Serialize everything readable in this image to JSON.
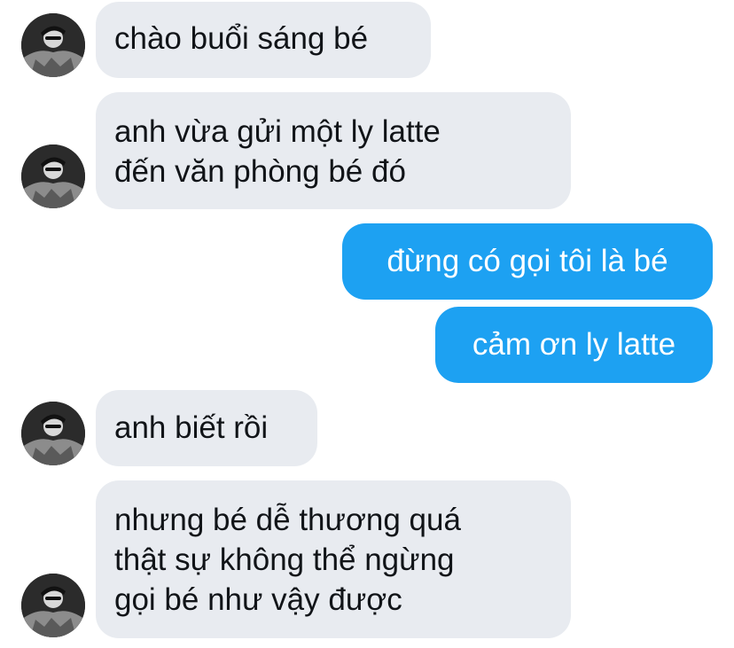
{
  "conversation": {
    "messages": [
      {
        "direction": "incoming",
        "lines": [
          "chào buổi sáng bé"
        ]
      },
      {
        "direction": "incoming",
        "lines": [
          "anh vừa gửi một ly latte",
          "đến văn phòng bé đó"
        ]
      },
      {
        "direction": "outgoing",
        "lines": [
          "đừng có gọi tôi là bé"
        ]
      },
      {
        "direction": "outgoing",
        "lines": [
          "cảm ơn ly latte"
        ]
      },
      {
        "direction": "incoming",
        "lines": [
          "anh biết rồi"
        ]
      },
      {
        "direction": "incoming",
        "lines": [
          "nhưng bé dễ thương quá",
          "thật sự không thể ngừng",
          "gọi bé như vậy được"
        ]
      }
    ]
  },
  "colors": {
    "incoming_bubble": "#e8ebf0",
    "outgoing_bubble": "#1da1f2",
    "incoming_text": "#111418",
    "outgoing_text": "#ffffff"
  },
  "icons": {
    "avatar": "user-avatar-icon"
  }
}
